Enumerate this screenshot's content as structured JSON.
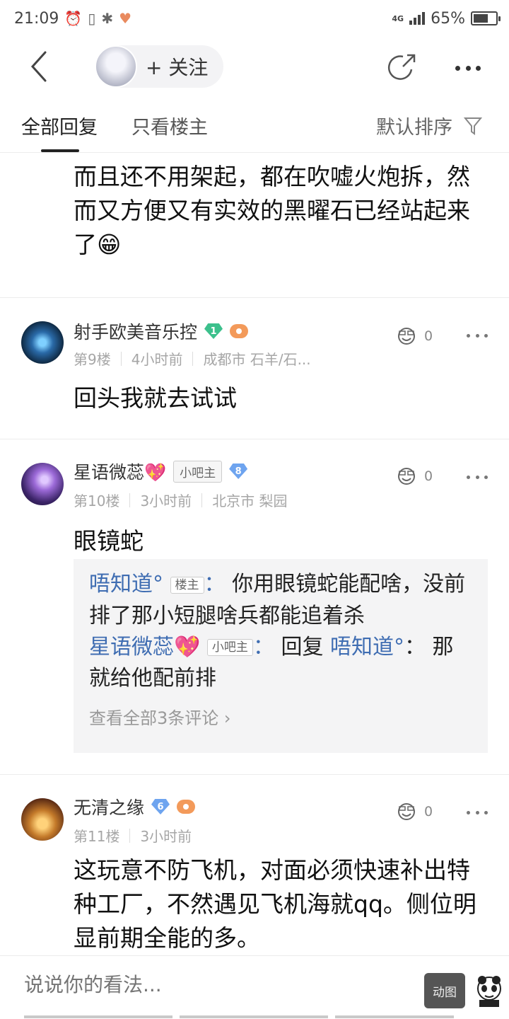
{
  "status_bar": {
    "time": "21:09",
    "network": "4G",
    "battery": "65%",
    "battery_level": 0.65
  },
  "nav": {
    "follow_label": "+ 关注"
  },
  "tabs": {
    "all": "全部回复",
    "owner_only": "只看楼主",
    "sort": "默认排序"
  },
  "top_post": {
    "text": "而且还不用架起，都在吹嘘火炮拆，然而又方便又有实效的黑曜石已经站起来了😁"
  },
  "replies": [
    {
      "user": "射手欧美音乐控",
      "level": "1",
      "level_color": "#3cc08c",
      "floor": "第9楼",
      "time": "4小时前",
      "location": "成都市 石羊/石...",
      "likes": "0",
      "content": "回头我就去试试"
    },
    {
      "user": "星语微蕊💖",
      "tag": "小吧主",
      "level": "8",
      "level_color": "#6ea4ef",
      "floor": "第10楼",
      "time": "3小时前",
      "location": "北京市 梨园",
      "likes": "0",
      "content": "眼镜蛇",
      "sub_comments": {
        "c1_user": "唔知道°",
        "c1_tag": "楼主",
        "c1_text": "你用眼镜蛇能配啥，没前排了那小短腿啥兵都能追着杀",
        "c2_user": "星语微蕊💖",
        "c2_tag": "小吧主",
        "c2_reply_word": "回复",
        "c2_target": "唔知道°",
        "c2_text": "那就给他配前排",
        "view_all": "查看全部3条评论"
      }
    },
    {
      "user": "无清之缘",
      "level": "6",
      "level_color": "#6ea4ef",
      "floor": "第11楼",
      "time": "3小时前",
      "likes": "0",
      "content": "这玩意不防飞机，对面必须快速补出特种工厂，不然遇见飞机海就qq。侧位明显前期全能的多。"
    }
  ],
  "bottom_bar": {
    "placeholder": "说说你的看法...",
    "gif_label": "动图"
  }
}
